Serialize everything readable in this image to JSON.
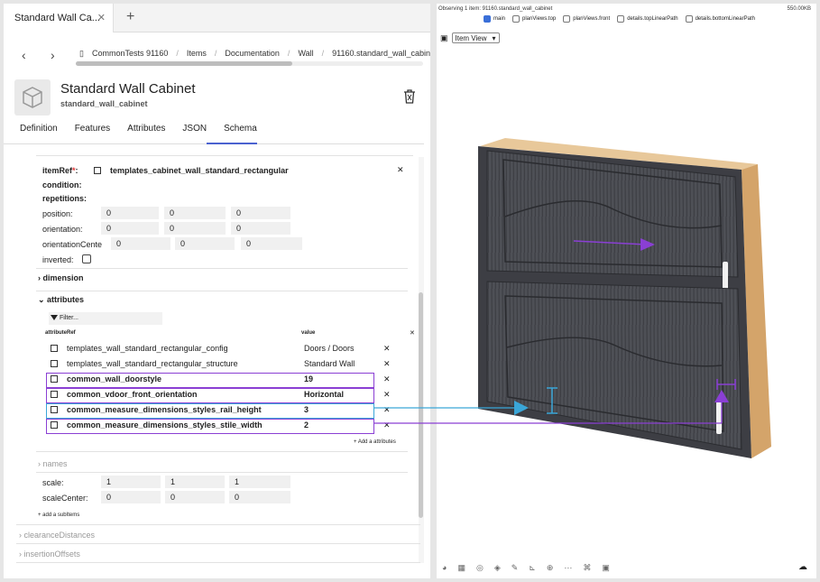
{
  "left": {
    "tab_title": "Standard Wall Ca...",
    "breadcrumb": [
      "CommonTests 91160",
      "Items",
      "Documentation",
      "Wall",
      "91160.standard_wall_cabinet"
    ],
    "title": "Standard Wall Cabinet",
    "subtitle": "standard_wall_cabinet",
    "tabs": [
      "Definition",
      "Features",
      "Attributes",
      "JSON",
      "Schema"
    ],
    "active_tab": "Schema",
    "item_ref_label": "itemRef",
    "item_ref_value": "templates_cabinet_wall_standard_rectangular",
    "condition_label": "condition:",
    "repetitions_label": "repetitions:",
    "position_label": "position:",
    "orientation_label": "orientation:",
    "orientation_center_label": "orientationCente",
    "inverted_label": "inverted:",
    "position": [
      "0",
      "0",
      "0"
    ],
    "orientation": [
      "0",
      "0",
      "0"
    ],
    "orientation_center": [
      "0",
      "0",
      "0"
    ],
    "dimension_label": "dimension",
    "attributes_label": "attributes",
    "filter_placeholder": "Filter...",
    "col_ref": "attributeRef",
    "col_value": "value",
    "rows": [
      {
        "ref": "templates_wall_standard_rectangular_config",
        "value": "Doors / Doors",
        "bold": false
      },
      {
        "ref": "templates_wall_standard_rectangular_structure",
        "value": "Standard Wall",
        "bold": false
      },
      {
        "ref": "common_wall_doorstyle",
        "value": "19",
        "bold": true
      },
      {
        "ref": "common_vdoor_front_orientation",
        "value": "Horizontal",
        "bold": true
      },
      {
        "ref": "common_measure_dimensions_styles_rail_height",
        "value": "3",
        "bold": true
      },
      {
        "ref": "common_measure_dimensions_styles_stile_width",
        "value": "2",
        "bold": true
      }
    ],
    "add_attributes": "+ Add a attributes",
    "names_label": "names",
    "scale_label": "scale:",
    "scale": [
      "1",
      "1",
      "1"
    ],
    "scale_center_label": "scaleCenter:",
    "scale_center": [
      "0",
      "0",
      "0"
    ],
    "add_subitems": "+ add a subItems",
    "clearance_label": "clearanceDistances",
    "insertion_label": "insertionOffsets"
  },
  "right": {
    "observing": "Observing 1 item: 91160.standard_wall_cabinet",
    "size": "550.00KB",
    "checkboxes": [
      {
        "label": "main",
        "checked": true
      },
      {
        "label": "planViews.top",
        "checked": false
      },
      {
        "label": "planViews.front",
        "checked": false
      },
      {
        "label": "details.topLinearPath",
        "checked": false
      },
      {
        "label": "details.bottomLinearPath",
        "checked": false
      }
    ],
    "view_select": "Item View"
  },
  "colors": {
    "purple": "#8a3fd4",
    "cyan": "#3aa6d8",
    "accent": "#4b62d0"
  }
}
